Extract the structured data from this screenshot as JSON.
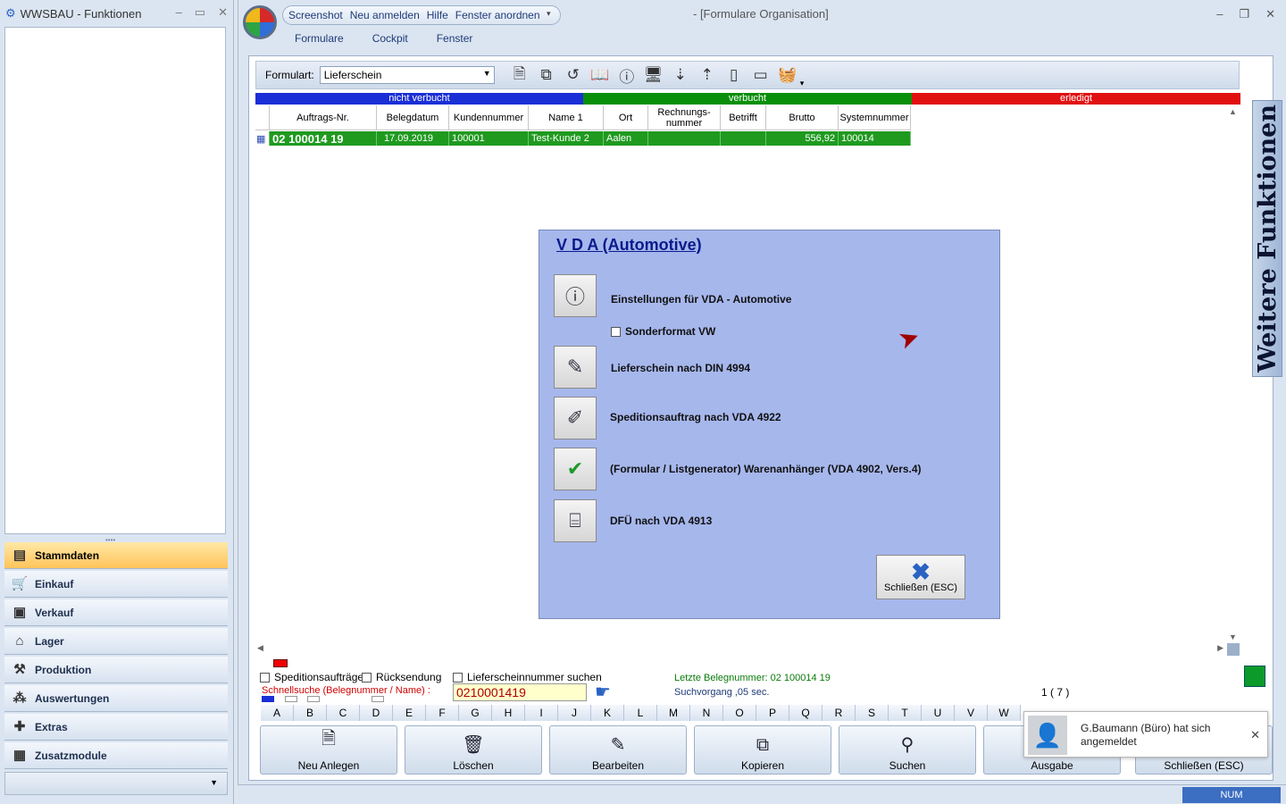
{
  "left_window": {
    "title": "WWSBAU - Funktionen",
    "nav": [
      {
        "label": "Stammdaten",
        "icon": "master-data-icon",
        "active": true
      },
      {
        "label": "Einkauf",
        "icon": "cart-icon"
      },
      {
        "label": "Verkauf",
        "icon": "register-icon"
      },
      {
        "label": "Lager",
        "icon": "warehouse-icon"
      },
      {
        "label": "Produktion",
        "icon": "production-icon"
      },
      {
        "label": "Auswertungen",
        "icon": "chart-icon"
      },
      {
        "label": "Extras",
        "icon": "extras-icon"
      },
      {
        "label": "Zusatzmodule",
        "icon": "modules-icon"
      }
    ]
  },
  "main_window": {
    "title": "- [Formulare Organisation]",
    "qat": [
      "Screenshot",
      "Neu anmelden",
      "Hilfe",
      "Fenster anordnen"
    ],
    "ribbon_tabs": [
      "Formulare",
      "Cockpit",
      "Fenster"
    ]
  },
  "toolbar": {
    "formularart_label": "Formulart:",
    "formularart_value": "Lieferschein"
  },
  "status_band": {
    "nicht_verbucht": "nicht verbucht",
    "verbucht": "verbucht",
    "erledigt": "erledigt"
  },
  "table": {
    "headers": [
      "Auftrags-Nr.",
      "Belegdatum",
      "Kundennummer",
      "Name 1",
      "Ort",
      "Rechnungs-\nnummer",
      "Betrifft",
      "Brutto",
      "Systemnummer"
    ],
    "rows": [
      [
        "02 100014 19",
        "17.09.2019",
        "100001",
        "Test-Kunde 2",
        "Aalen",
        "",
        "",
        "556,92",
        "100014"
      ]
    ]
  },
  "dialog": {
    "title": "V D A  (Automotive)",
    "items": [
      {
        "label": "Einstellungen für VDA - Automotive",
        "icon": "settings-info-icon"
      },
      {
        "label": "Lieferschein nach DIN 4994",
        "icon": "edit-document-icon"
      },
      {
        "label": "Speditionsauftrag nach VDA 4922",
        "icon": "truck-pen-icon"
      },
      {
        "label": "(Formular / Listgenerator) Warenanhänger (VDA 4902, Vers.4)",
        "icon": "checked-tag-icon"
      },
      {
        "label": "DFÜ nach VDA 4913",
        "icon": "router-icon"
      }
    ],
    "checkbox_sonderformat": "Sonderformat VW",
    "close_label": "Schließen (ESC)"
  },
  "side_tab": "Weitere Funktionen",
  "bottom": {
    "chk_spedition": "Speditionsaufträge",
    "chk_ruecksendung": "Rücksendung",
    "chk_lieferscheinnr": "Lieferscheinnummer suchen",
    "schnellsuche_label": "Schnellsuche (Belegnummer / Name) :",
    "search_value": "0210001419",
    "last_number": "Letzte Belegnummer: 02 100014 19",
    "search_time": "Suchvorgang ,05 sec.",
    "record_count": "1 ( 7 )",
    "letters": [
      "A",
      "B",
      "C",
      "D",
      "E",
      "F",
      "G",
      "H",
      "I",
      "J",
      "K",
      "L",
      "M",
      "N",
      "O",
      "P",
      "Q",
      "R",
      "S",
      "T",
      "U",
      "V",
      "W"
    ],
    "buttons": [
      "Neu Anlegen",
      "Löschen",
      "Bearbeiten",
      "Kopieren",
      "Suchen",
      "Ausgabe",
      "Schließen (ESC)"
    ]
  },
  "toast": {
    "message": "G.Baumann (Büro) hat sich angemeldet"
  },
  "statusbar": {
    "num": "NUM"
  }
}
